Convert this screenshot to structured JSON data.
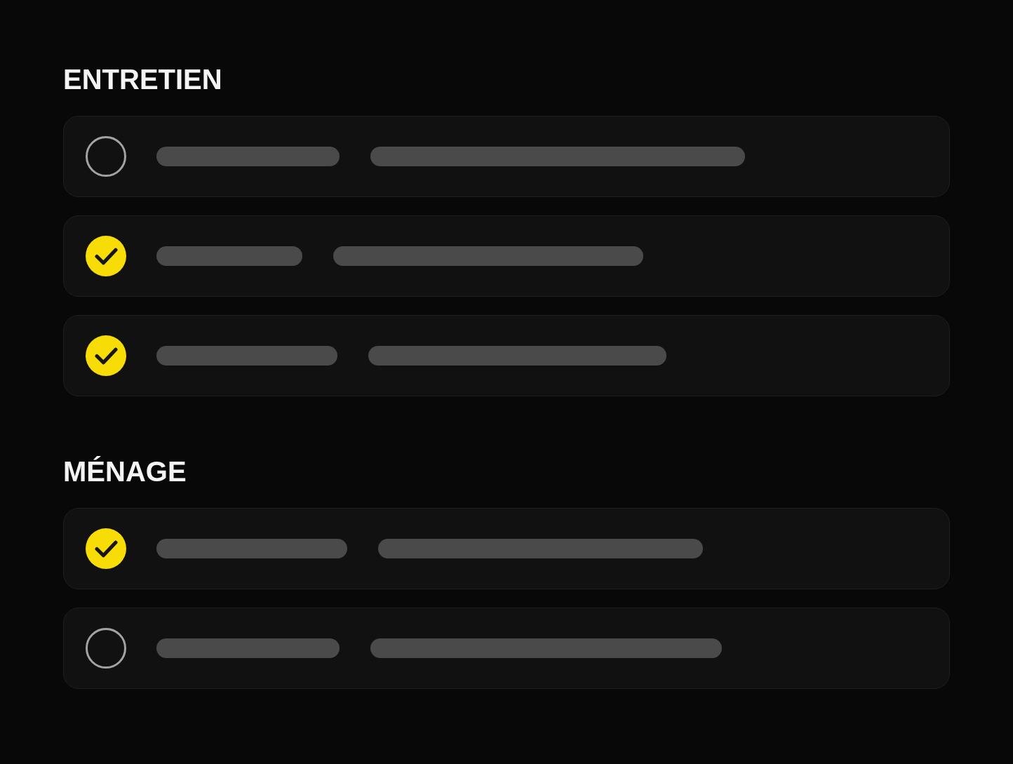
{
  "sections": [
    {
      "title": "ENTRETIEN",
      "items": [
        {
          "checked": false
        },
        {
          "checked": true
        },
        {
          "checked": true
        }
      ]
    },
    {
      "title": "MÉNAGE",
      "items": [
        {
          "checked": true
        },
        {
          "checked": false
        }
      ]
    }
  ]
}
